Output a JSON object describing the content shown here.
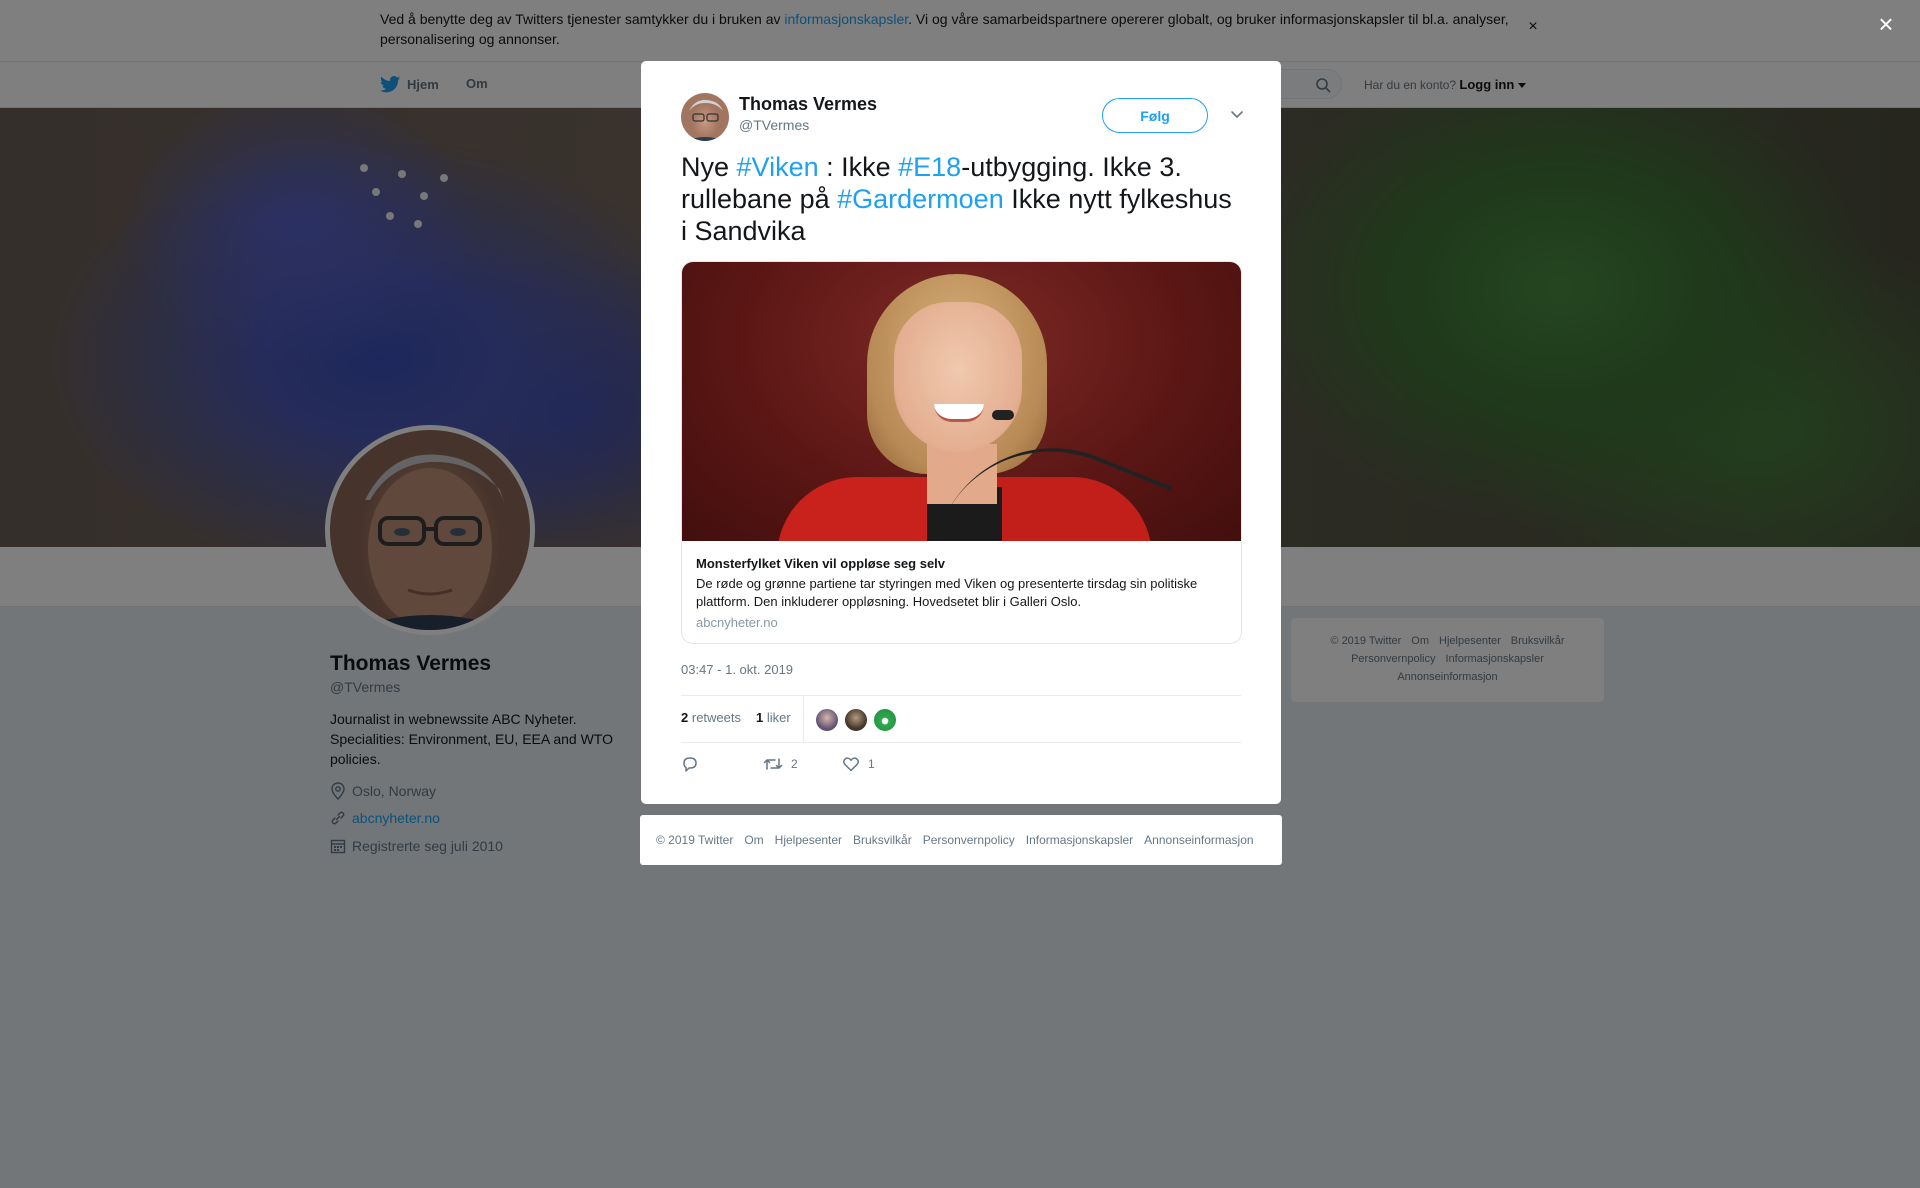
{
  "cookie_bar": {
    "text_before": "Ved å benytte deg av Twitters tjenester samtykker du i bruken av ",
    "link": "informasjonskapsler",
    "text_after": ". Vi og våre samarbeidspartnere opererer globalt, og bruker informasjonskapsler til bl.a. analyser, personalisering og annonser.",
    "close": "×"
  },
  "nav": {
    "home": "Hjem",
    "about": "Om",
    "login_prompt": "Har du en konto?",
    "login": "Logg inn"
  },
  "profile": {
    "name": "Thomas Vermes",
    "handle": "@TVermes",
    "bio": "Journalist in webnewssite ABC Nyheter. Specialities: Environment, EU, EEA and WTO policies.",
    "location": "Oslo, Norway",
    "website": "abcnyheter.no",
    "joined": "Registrerte seg juli 2010"
  },
  "side_footer": {
    "items": [
      "© 2019 Twitter",
      "Om",
      "Hjelpesenter",
      "Bruksvilkår",
      "Personvernpolicy",
      "Informasjonskapsler",
      "Annonseinformasjon"
    ]
  },
  "overlay": {
    "close": "×"
  },
  "tweet": {
    "author_name": "Thomas Vermes",
    "author_handle": "@TVermes",
    "follow": "Følg",
    "text": {
      "p1": "Nye ",
      "tag1": "#Viken",
      "p2": " : Ikke ",
      "tag2": "#E18",
      "p3": "-utbygging. Ikke 3. rullebane på ",
      "tag3": "#Gardermoen",
      "p4": " Ikke nytt fylkeshus i Sandvika"
    },
    "card": {
      "title": "Monsterfylket Viken vil oppløse seg selv",
      "description": "De røde og grønne partiene tar styringen med Viken og presenterte tirsdag sin politiske plattform. Den inkluderer oppløsning. Hovedsetet blir i Galleri Oslo.",
      "domain": "abcnyheter.no"
    },
    "time": "03:47 - 1. okt. 2019",
    "retweets_count": "2",
    "retweets_label": "retweets",
    "likes_count": "1",
    "likes_label": "liker",
    "action_retweet_count": "2",
    "action_like_count": "1"
  },
  "modal_footer": {
    "items": [
      "© 2019 Twitter",
      "Om",
      "Hjelpesenter",
      "Bruksvilkår",
      "Personvernpolicy",
      "Informasjonskapsler",
      "Annonseinformasjon"
    ]
  },
  "colors": {
    "accent": "#1da1f2",
    "overlay": "rgba(0,0,0,0.5)"
  }
}
